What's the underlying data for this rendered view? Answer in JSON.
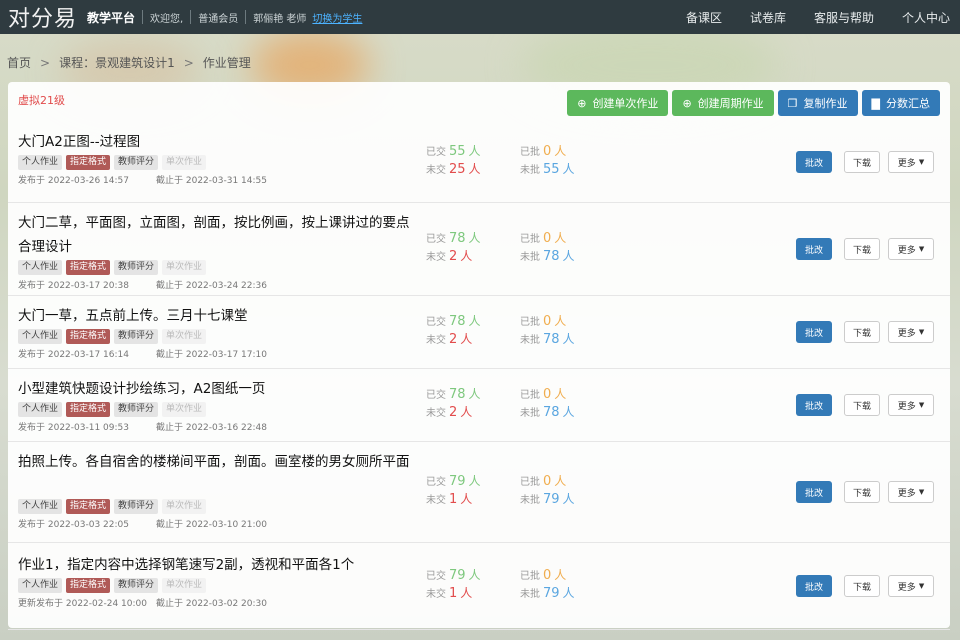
{
  "topbar": {
    "logo": "对分易",
    "platform": "教学平台",
    "welcome": "欢迎您,",
    "member": "普通会员",
    "teacher": "郭俪艳  老师",
    "switch_link": "切换为学生",
    "nav": [
      "备课区",
      "试卷库",
      "客服与帮助",
      "个人中心"
    ]
  },
  "breadcrumb": [
    "首页",
    "课程：景观建筑设计1",
    "作业管理"
  ],
  "panel": {
    "group_label": "虚拟21级",
    "actions": [
      {
        "label": "创建单次作业",
        "icon": "plus-circle-icon",
        "color": "#5cb85c"
      },
      {
        "label": "创建周期作业",
        "icon": "plus-circle-icon",
        "color": "#5cb85c"
      },
      {
        "label": "复制作业",
        "icon": "copy-icon",
        "color": "#337ab7"
      },
      {
        "label": "分数汇总",
        "icon": "bar-chart-icon",
        "color": "#337ab7"
      }
    ]
  },
  "labels": {
    "submitted": "已交",
    "not_submitted": "未交",
    "graded": "已批",
    "not_graded": "未批",
    "unit": "人",
    "grade_btn": "批改",
    "download_btn": "下载",
    "more_btn": "更多"
  },
  "assignments": [
    {
      "title": "大门A2正图--过程图",
      "tags": [
        "个人作业",
        "指定格式",
        "教师评分",
        "单次作业"
      ],
      "published": "发布于 2022-03-26 14:57",
      "deadline": "截止于 2022-03-31 14:55",
      "submitted": "55",
      "not_submitted": "25",
      "graded": "0",
      "not_graded": "55"
    },
    {
      "title": "大门二草，平面图，立面图，剖面，按比例画，按上课讲过的要点合理设计",
      "tags": [
        "个人作业",
        "指定格式",
        "教师评分",
        "单次作业"
      ],
      "published": "发布于 2022-03-17 20:38",
      "deadline": "截止于 2022-03-24 22:36",
      "submitted": "78",
      "not_submitted": "2",
      "graded": "0",
      "not_graded": "78"
    },
    {
      "title": "大门一草，五点前上传。三月十七课堂",
      "tags": [
        "个人作业",
        "指定格式",
        "教师评分",
        "单次作业"
      ],
      "published": "发布于 2022-03-17 16:14",
      "deadline": "截止于 2022-03-17 17:10",
      "submitted": "78",
      "not_submitted": "2",
      "graded": "0",
      "not_graded": "78"
    },
    {
      "title": "小型建筑快题设计抄绘练习，A2图纸一页",
      "tags": [
        "个人作业",
        "指定格式",
        "教师评分",
        "单次作业"
      ],
      "published": "发布于 2022-03-11 09:53",
      "deadline": "截止于 2022-03-16 22:48",
      "submitted": "78",
      "not_submitted": "2",
      "graded": "0",
      "not_graded": "78"
    },
    {
      "title": "拍照上传。各自宿舍的楼梯间平面，剖面。画室楼的男女厕所平面",
      "tags": [
        "个人作业",
        "指定格式",
        "教师评分",
        "单次作业"
      ],
      "published": "发布于 2022-03-03 22:05",
      "deadline": "截止于 2022-03-10 21:00",
      "submitted": "79",
      "not_submitted": "1",
      "graded": "0",
      "not_graded": "79"
    },
    {
      "title": "作业1，指定内容中选择钢笔速写2副，透视和平面各1个",
      "tags": [
        "个人作业",
        "指定格式",
        "教师评分",
        "单次作业"
      ],
      "published": "更新发布于 2022-02-24 10:00",
      "deadline": "截止于 2022-03-02 20:30",
      "submitted": "79",
      "not_submitted": "1",
      "graded": "0",
      "not_graded": "79"
    }
  ]
}
